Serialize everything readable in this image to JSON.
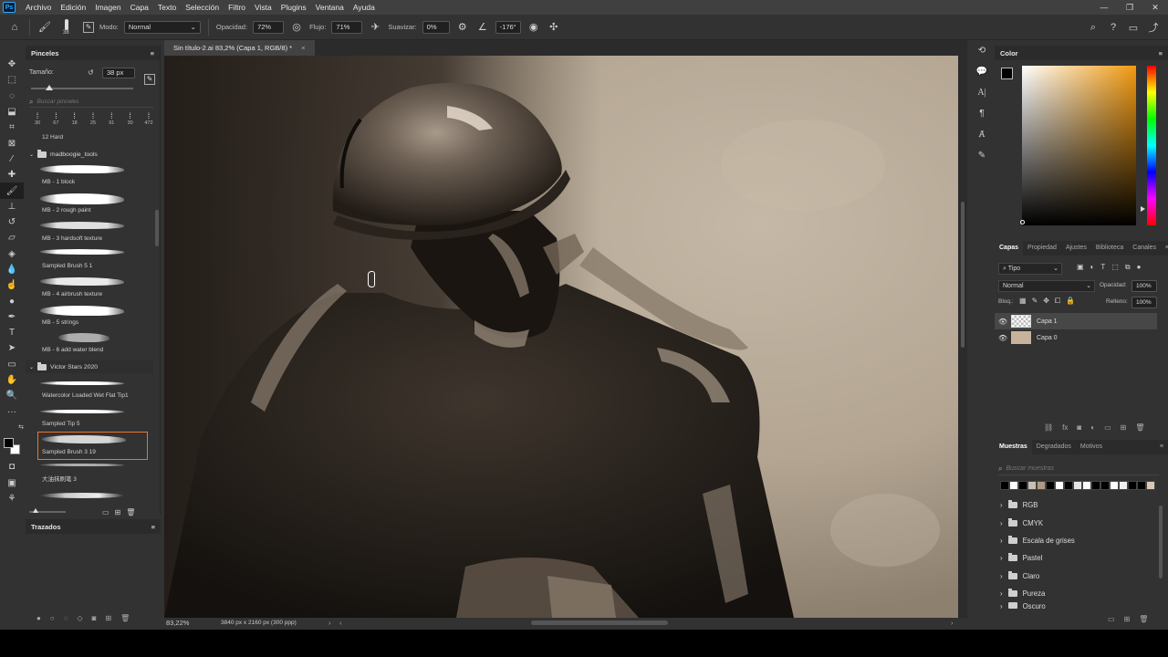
{
  "app": {
    "logo": "Ps"
  },
  "menu": [
    "Archivo",
    "Edición",
    "Imagen",
    "Capa",
    "Texto",
    "Selección",
    "Filtro",
    "Vista",
    "Plugins",
    "Ventana",
    "Ayuda"
  ],
  "window_controls": [
    "—",
    "❐",
    "✕"
  ],
  "options": {
    "brush_size_badge": "38",
    "mode_label": "Modo:",
    "mode_value": "Normal",
    "opacity_label": "Opacidad:",
    "opacity_value": "72%",
    "flow_label": "Flujo:",
    "flow_value": "71%",
    "smoothing_label": "Suavizar:",
    "smoothing_value": "0%",
    "angle_value": "-176°"
  },
  "brushes": {
    "panel_title": "Pinceles",
    "size_label": "Tamaño:",
    "size_value": "38 px",
    "search_placeholder": "Buscar pinceles",
    "recent_sizes": [
      "30",
      "67",
      "18",
      "25",
      "91",
      "30",
      "472"
    ],
    "hard_label": "12 Hard",
    "groups": [
      {
        "name": "madboogie_tools"
      },
      {
        "name": "Victor Stars 2020"
      }
    ],
    "items": [
      "MB - 1 block",
      "MB - 2 rough paint",
      "MB - 3 hardsoft texture",
      "Sampled Brush 5 1",
      "MB - 4 airbrush texture",
      "MB - 5 strings",
      "MB - 6 add water blend",
      "Watercolor Loaded Wet Flat Tip1",
      "Sampled Tip 5",
      "Sampled Brush 3 19",
      "大油抹刷笔 3"
    ],
    "selected_item": "Sampled Brush 3 19"
  },
  "paths_panel": {
    "title": "Trazados"
  },
  "document": {
    "tab_title": "Sin título-2.ai 83,2% (Capa 1, RGB/8) *",
    "zoom": "83,22%",
    "dimensions": "3840 px x 2160 px (300 ppp)"
  },
  "color_panel": {
    "title": "Color"
  },
  "layers_panel": {
    "tabs": [
      "Capas",
      "Propiedad",
      "Ajustes",
      "Biblioteca",
      "Canales"
    ],
    "filter_label": "Tipo",
    "blend_mode": "Normal",
    "opacity_label": "Opacidad:",
    "opacity_value": "100%",
    "lock_label": "Bloq.:",
    "fill_label": "Relleno:",
    "fill_value": "100%",
    "layers": [
      {
        "name": "Capa 1",
        "selected": true
      },
      {
        "name": "Capa 0",
        "selected": false
      }
    ]
  },
  "swatches_panel": {
    "tabs": [
      "Muestras",
      "Degradados",
      "Motivos"
    ],
    "search_placeholder": "Buscar muestras",
    "swatch_colors": [
      "#000000",
      "#ffffff",
      "#000000",
      "#c8c0b4",
      "#b09a82",
      "#000000",
      "#ffffff",
      "#000000",
      "#e6e6e6",
      "#ffffff",
      "#000000",
      "#000000",
      "#ffffff",
      "#f0f0f0",
      "#000000",
      "#000000",
      "#d8c8b4"
    ],
    "groups": [
      "RGB",
      "CMYK",
      "Escala de grises",
      "Pastel",
      "Claro",
      "Pureza",
      "Oscuro"
    ]
  },
  "colors": {
    "accent_selected": "#e8762d",
    "fg": "#000000",
    "bg": "#ffffff"
  }
}
